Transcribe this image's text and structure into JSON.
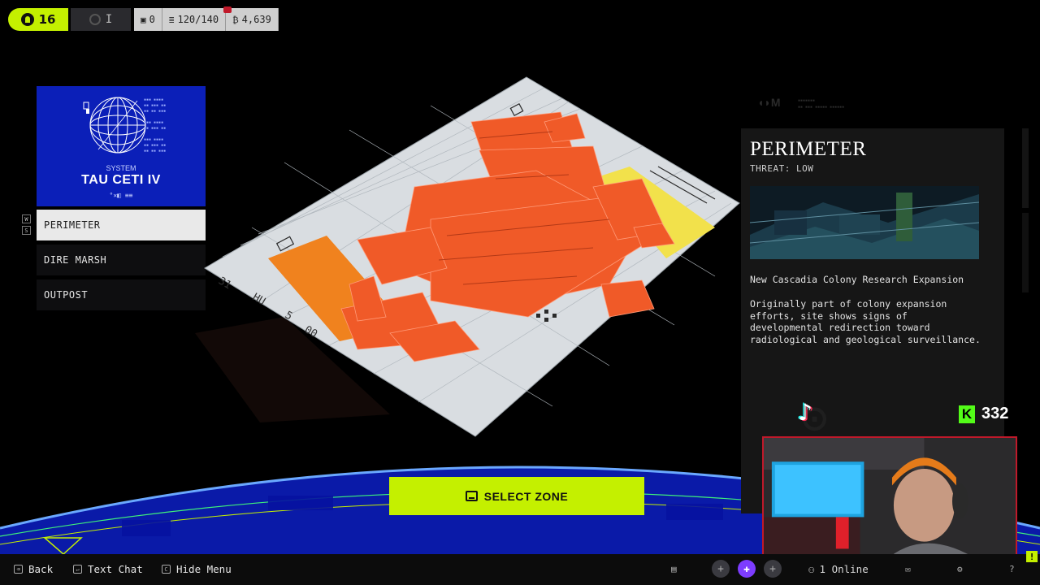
{
  "hud": {
    "level": "16",
    "rank": "I",
    "counter_a": "0",
    "capacity": "120/140",
    "credits": "4,639"
  },
  "system": {
    "label": "SYSTEM",
    "name": "TAU CETI IV",
    "glyphs": "°✕◧ ≡≡"
  },
  "nav_keys": [
    "W",
    "S"
  ],
  "zones": [
    {
      "label": "PERIMETER",
      "active": true
    },
    {
      "label": "DIRE MARSH",
      "active": false
    },
    {
      "label": "OUTPOST",
      "active": false
    }
  ],
  "map_labels": [
    "31",
    "HU",
    "5",
    "00"
  ],
  "select_button": "SELECT ZONE",
  "zone_info": {
    "title": "PERIMETER",
    "threat": "THREAT: LOW",
    "subtitle": "New Cascadia Colony Research Expansion",
    "description": "Originally part of colony expansion efforts, site shows signs of developmental redirection toward radiological and geological surveillance."
  },
  "stream": {
    "kick_count": "332"
  },
  "bottom_bar": {
    "back": "Back",
    "text_chat": "Text Chat",
    "hide_menu": "Hide Menu",
    "online": "1 Online"
  },
  "colors": {
    "accent": "#c4f000",
    "system_card": "#0b1fb8",
    "map_orange": "#f05a28",
    "map_yellow": "#f2e14b"
  }
}
